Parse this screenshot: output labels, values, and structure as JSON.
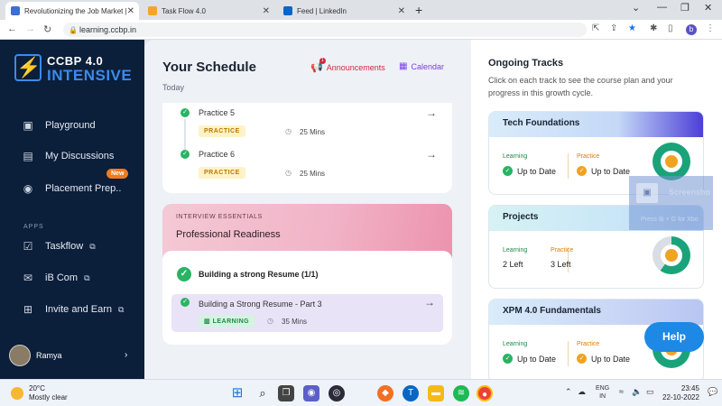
{
  "browser": {
    "tabs": [
      {
        "title": "Revolutionizing the Job Market |",
        "active": true,
        "favicon_color": "#3b6fd4"
      },
      {
        "title": "Task Flow 4.0",
        "active": false,
        "favicon_color": "#f5a623"
      },
      {
        "title": "Feed | LinkedIn",
        "active": false,
        "favicon_color": "#0a66c2"
      }
    ],
    "new_tab_icon": "plus-icon",
    "url": "learning.ccbp.in",
    "profile_initial": "b"
  },
  "sidebar": {
    "logo_line1": "CCBP 4.0",
    "logo_line2": "INTENSIVE",
    "items": [
      {
        "label": "Playground",
        "icon": "terminal-icon"
      },
      {
        "label": "My Discussions",
        "icon": "chat-icon"
      },
      {
        "label": "Placement Prep..",
        "icon": "person-icon",
        "badge": "New"
      }
    ],
    "apps_heading": "APPS",
    "apps": [
      {
        "label": "Taskflow",
        "icon": "check-box-icon"
      },
      {
        "label": "iB Com",
        "icon": "megaphone-icon"
      },
      {
        "label": "Invite and Earn",
        "icon": "gift-icon"
      }
    ],
    "user_name": "Ramya"
  },
  "schedule": {
    "title": "Your Schedule",
    "subtitle": "Today",
    "announcements_label": "Announcements",
    "announcements_count": "1",
    "calendar_label": "Calendar",
    "practice_items": [
      {
        "title": "Practice 5",
        "badge": "PRACTICE",
        "duration": "25 Mins"
      },
      {
        "title": "Practice 6",
        "badge": "PRACTICE",
        "duration": "25 Mins"
      }
    ],
    "essentials": {
      "tag": "INTERVIEW ESSENTIALS",
      "title": "Professional Readiness",
      "heading": "Building a strong Resume (1/1)",
      "item_title": "Building a Strong Resume - Part 3",
      "item_badge": "LEARNING",
      "item_duration": "35 Mins"
    }
  },
  "tracks": {
    "title": "Ongoing Tracks",
    "description": "Click on each track to see the course plan and your progress in this growth cycle.",
    "items": [
      {
        "name": "Tech Foundations",
        "learning_label": "Learning",
        "learning_value": "Up to Date",
        "practice_label": "Practice",
        "practice_value": "Up to Date",
        "progress": 1.0
      },
      {
        "name": "Projects",
        "learning_label": "Learning",
        "learning_value": "2 Left",
        "practice_label": "Practice",
        "practice_value": "3 Left",
        "progress": 0.6
      },
      {
        "name": "XPM 4.0 Fundamentals",
        "learning_label": "Learning",
        "learning_value": "Up to Date",
        "practice_label": "Practice",
        "practice_value": "Up to Date",
        "progress": 1.0
      }
    ]
  },
  "overlay": {
    "label": "Screensho",
    "hint": "Press ⊞ + G for Xbo"
  },
  "help_label": "Help",
  "taskbar": {
    "temperature": "20°C",
    "weather": "Mostly clear",
    "lang1": "ENG",
    "lang2": "IN",
    "time": "23:45",
    "date": "22-10-2022"
  },
  "colors": {
    "sidebar_bg": "#0b1e3a",
    "accent_blue": "#3b8beb",
    "ring_green": "#1aa37a",
    "ring_orange": "#f0a321"
  }
}
